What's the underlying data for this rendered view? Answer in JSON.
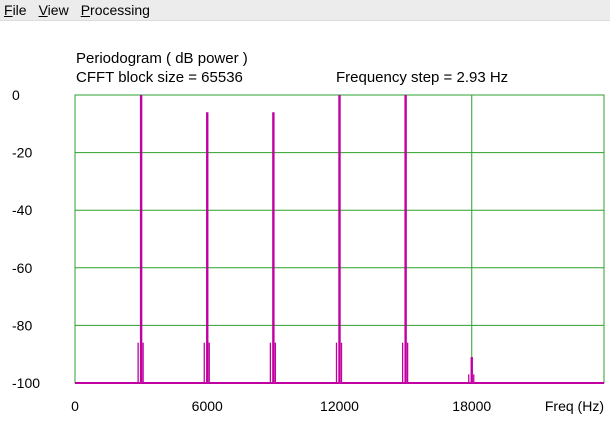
{
  "menu": [
    {
      "label": "File",
      "mnemonic": "F",
      "rest": "ile"
    },
    {
      "label": "View",
      "mnemonic": "V",
      "rest": "iew"
    },
    {
      "label": "Processing",
      "mnemonic": "P",
      "rest": "rocessing"
    }
  ],
  "plot": {
    "title": "Periodogram  ( dB power )",
    "block_size_label": "CFFT block size = 65536",
    "frequency_step_label": "Frequency step =  2.93  Hz"
  },
  "chart_data": {
    "type": "line",
    "xlabel": "Freq (Hz)",
    "ylabel": "",
    "xlim": [
      0,
      24000
    ],
    "ylim": [
      -100,
      0
    ],
    "x_ticks": [
      0,
      6000,
      12000,
      18000
    ],
    "y_ticks": [
      0,
      -20,
      -40,
      -60,
      -80,
      -100
    ],
    "x_tick_labels": [
      "0",
      "6000",
      "12000",
      "18000"
    ],
    "y_tick_labels": [
      "0",
      "-20",
      "-40",
      "-60",
      "-80",
      "-100"
    ],
    "vertical_gridlines_at": [
      18000
    ],
    "grid": true,
    "grid_color": "#2ca02c",
    "line_color": "#c000a0",
    "baseline_db": -100,
    "peaks": [
      {
        "freq": 3000,
        "db": 0,
        "sidelobe_db": -86
      },
      {
        "freq": 6000,
        "db": -6,
        "sidelobe_db": -86
      },
      {
        "freq": 9000,
        "db": -6,
        "sidelobe_db": -86
      },
      {
        "freq": 12000,
        "db": 0,
        "sidelobe_db": -86
      },
      {
        "freq": 15000,
        "db": 0,
        "sidelobe_db": -86
      },
      {
        "freq": 18000,
        "db": -91,
        "sidelobe_db": -97
      }
    ]
  },
  "colors": {
    "menubar_bg": "#ececec",
    "grid": "#2ca02c",
    "trace": "#c000a0"
  }
}
